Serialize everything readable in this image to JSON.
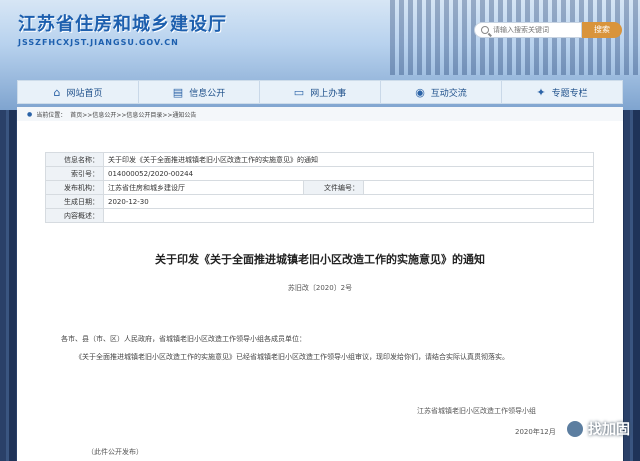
{
  "header": {
    "site_title": "江苏省住房和城乡建设厅",
    "site_url": "JSSZFHCXJST.JIANGSU.GOV.CN",
    "search_placeholder": "请输入搜索关键词",
    "search_button": "搜索"
  },
  "nav": {
    "items": [
      {
        "label": "网站首页",
        "icon": "home-icon"
      },
      {
        "label": "信息公开",
        "icon": "document-icon"
      },
      {
        "label": "网上办事",
        "icon": "monitor-icon"
      },
      {
        "label": "互动交流",
        "icon": "chat-icon"
      },
      {
        "label": "专题专栏",
        "icon": "lightbulb-icon"
      }
    ]
  },
  "breadcrumb": {
    "prefix": "当前位置：",
    "path": "首页>>信息公开>>信息公开目录>>通知公告"
  },
  "meta": {
    "name_label": "信息名称：",
    "name_value": "关于印发《关于全面推进城镇老旧小区改造工作的实施意见》的通知",
    "index_label": "索引号：",
    "index_value": "014000052/2020-00244",
    "org_label": "发布机构：",
    "org_value": "江苏省住房和城乡建设厅",
    "fileno_label": "文件编号：",
    "fileno_value": "",
    "date_label": "生成日期：",
    "date_value": "2020-12-30",
    "summary_label": "内容概述：",
    "summary_value": ""
  },
  "doc": {
    "title": "关于印发《关于全面推进城镇老旧小区改造工作的实施意见》的通知",
    "number": "苏旧改〔2020〕2号",
    "greeting": "各市、县（市、区）人民政府，省城镇老旧小区改造工作领导小组各成员单位：",
    "body": "《关于全面推进城镇老旧小区改造工作的实施意见》已经省城镇老旧小区改造工作领导小组审议，现印发给你们，请结合实际认真贯彻落实。",
    "signature": "江苏省城镇老旧小区改造工作领导小组",
    "date": "2020年12月",
    "note": "（此件公开发布）"
  },
  "watermark": {
    "text": "找加固"
  }
}
